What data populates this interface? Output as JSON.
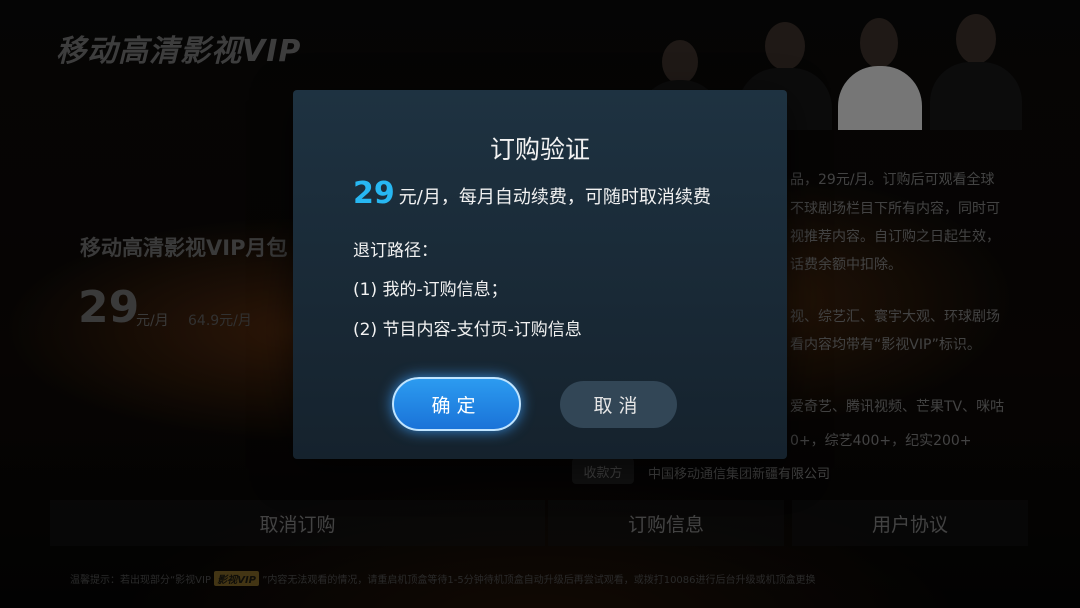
{
  "brand": "移动高清影视VIP",
  "plan": {
    "title": "移动高清影视VIP月包",
    "price": "29",
    "unit": "元/月",
    "original": "64.9元/月"
  },
  "description": [
    "品，29元/月。订购后可观看全球",
    "不球剧场栏目下所有内容，同时可",
    "视推荐内容。自订购之日起生效，",
    "话费余额中扣除。",
    "视、综艺汇、寰宇大观、环球剧场",
    "看内容均带有“影视VIP”标识。",
    "爱奇艺、腾讯视频、芒果TV、咪咕",
    "0+，综艺400+，纪实200+"
  ],
  "payee": {
    "label": "收款方",
    "value": "中国移动通信集团新疆有限公司"
  },
  "bottom_tabs": [
    "取消订购",
    "订购信息",
    "用户协议"
  ],
  "tip": {
    "before": "温馨提示：若出现部分“影视VIP",
    "badge": "影视VIP",
    "after": "”内容无法观看的情况，请重启机顶盒等待1-5分钟待机顶盒自动升级后再尝试观看，或拨打10086进行后台升级或机顶盒更换"
  },
  "modal": {
    "title": "订购验证",
    "price": "29",
    "price_rest": "元/月，每月自动续费，可随时取消续费",
    "route_label": "退订路径：",
    "route_1": "(1) 我的-订购信息；",
    "route_2": "(2) 节目内容-支付页-订购信息",
    "confirm": "确定",
    "cancel": "取消"
  },
  "colors": {
    "accent": "#27b7f2",
    "modal_bg": "#1a2a37",
    "button_primary": "#2287e6"
  }
}
